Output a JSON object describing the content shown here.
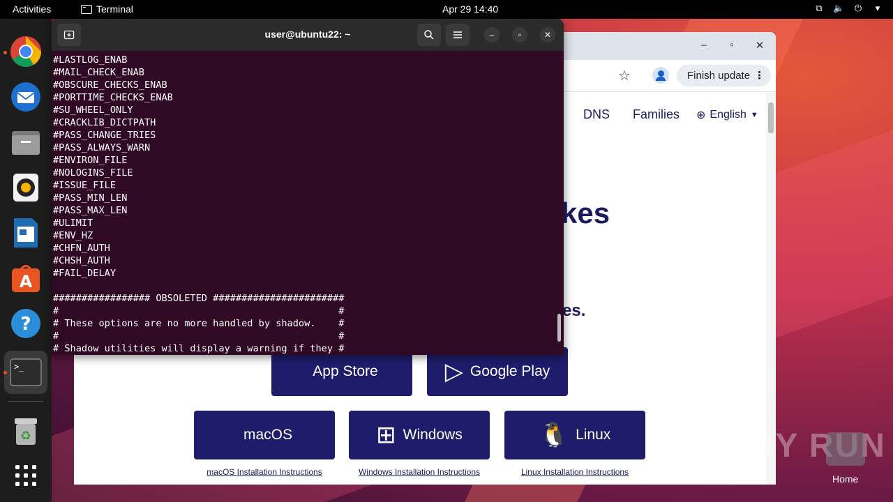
{
  "topbar": {
    "activities": "Activities",
    "app_name": "Terminal",
    "clock": "Apr 29  14:40"
  },
  "dock": {
    "items": [
      "chrome-icon",
      "thunderbird-icon",
      "files-icon",
      "rhythmbox-icon",
      "writer-icon",
      "app-center-icon",
      "help-icon",
      "terminal-icon",
      "trash-icon",
      "app-grid-icon"
    ]
  },
  "browser": {
    "finish_update": "Finish update",
    "nav": [
      "DNS",
      "Families"
    ],
    "language": "English",
    "hero_partial_1": "kes",
    "hero_partial_2": "es.",
    "store_buttons": [
      "App Store",
      "Google Play"
    ],
    "os_buttons": [
      "macOS",
      "Windows",
      "Linux"
    ],
    "install_links": [
      "macOS Installation Instructions",
      "Windows Installation Instructions",
      "Linux Installation Instructions"
    ]
  },
  "terminal": {
    "title": "user@ubuntu22: ~",
    "lines": [
      "#LASTLOG_ENAB",
      "#MAIL_CHECK_ENAB",
      "#OBSCURE_CHECKS_ENAB",
      "#PORTTIME_CHECKS_ENAB",
      "#SU_WHEEL_ONLY",
      "#CRACKLIB_DICTPATH",
      "#PASS_CHANGE_TRIES",
      "#PASS_ALWAYS_WARN",
      "#ENVIRON_FILE",
      "#NOLOGINS_FILE",
      "#ISSUE_FILE",
      "#PASS_MIN_LEN",
      "#PASS_MAX_LEN",
      "#ULIMIT",
      "#ENV_HZ",
      "#CHFN_AUTH",
      "#CHSH_AUTH",
      "#FAIL_DELAY",
      "",
      "################# OBSOLETED #######################",
      "#                                                 #",
      "# These options are no more handled by shadow.    #",
      "#                                                 #",
      "# Shadow utilities will display a warning if they #"
    ]
  },
  "desktop": {
    "watermark": "ANY RUN",
    "home_label": "Home"
  }
}
